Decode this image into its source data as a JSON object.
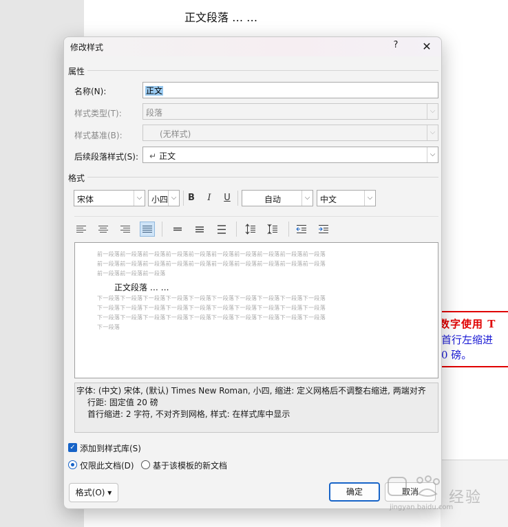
{
  "document": {
    "heading": "正文段落 … …",
    "note_lines": [
      "数字使用 T",
      "首行左缩进",
      "0 磅。"
    ]
  },
  "dialog": {
    "title": "修改样式",
    "help_label": "?",
    "close_label": "✕",
    "properties": {
      "section_label": "属性",
      "name_label": "名称(N):",
      "name_value": "正文",
      "style_type_label": "样式类型(T):",
      "style_type_value": "段落",
      "style_based_label": "样式基准(B):",
      "style_based_value": "(无样式)",
      "next_style_label": "后续段落样式(S):",
      "next_style_value": "正文",
      "next_style_glyph": "↵"
    },
    "format": {
      "section_label": "格式",
      "font_value": "宋体",
      "size_value": "小四",
      "bold_label": "B",
      "italic_label": "I",
      "underline_label": "U",
      "color_value": "自动",
      "script_value": "中文"
    },
    "preview": {
      "prev_paragraph_lines": [
        "前一段落前一段落前一段落前一段落前一段落前一段落前一段落前一段落前一段落前一段落",
        "前一段落前一段落前一段落前一段落前一段落前一段落前一段落前一段落前一段落前一段落",
        "前一段落前一段落前一段落"
      ],
      "sample_text": "正文段落 … …",
      "next_paragraph_lines": [
        "下一段落下一段落下一段落下一段落下一段落下一段落下一段落下一段落下一段落下一段落",
        "下一段落下一段落下一段落下一段落下一段落下一段落下一段落下一段落下一段落下一段落",
        "下一段落下一段落下一段落下一段落下一段落下一段落下一段落下一段落下一段落下一段落",
        "下一段落"
      ]
    },
    "description": {
      "line1": "字体: (中文) 宋体, (默认) Times New Roman, 小四, 缩进: 定义网格后不调整右缩进, 两端对齐",
      "line2": "行距: 固定值 20 磅",
      "line3": "首行缩进: 2 字符, 不对齐到网格, 样式: 在样式库中显示"
    },
    "options": {
      "add_to_gallery_label": "添加到样式库(S)",
      "add_to_gallery_checked": true,
      "only_this_doc_label": "仅限此文档(D)",
      "new_docs_label": "基于该模板的新文档",
      "selected_scope": "only_this_doc"
    },
    "buttons": {
      "format_label": "格式(O)",
      "format_arrow": "▾",
      "ok_label": "确定",
      "cancel_label": "取消"
    }
  },
  "watermark": {
    "text": "经验",
    "url": "jingyan.baidu.com"
  }
}
